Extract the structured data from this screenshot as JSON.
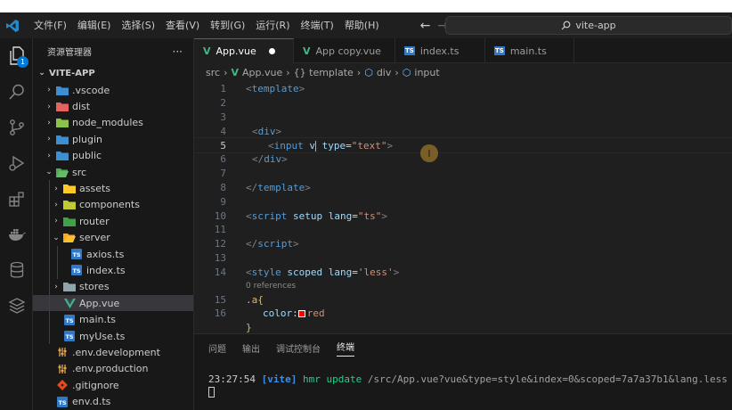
{
  "titlebar": {
    "menu": [
      "文件(F)",
      "编辑(E)",
      "选择(S)",
      "查看(V)",
      "转到(G)",
      "运行(R)",
      "终端(T)",
      "帮助(H)"
    ],
    "search_text": "vite-app"
  },
  "activity_bar": {
    "explorer_badge": "1"
  },
  "sidebar": {
    "header": "资源管理器",
    "more": "···",
    "section": "VITE-APP",
    "items": [
      {
        "label": ".vscode",
        "kind": "folder"
      },
      {
        "label": "dist",
        "kind": "folder"
      },
      {
        "label": "node_modules",
        "kind": "folder"
      },
      {
        "label": "plugin",
        "kind": "folder"
      },
      {
        "label": "public",
        "kind": "folder"
      },
      {
        "label": "src",
        "kind": "folder-open"
      },
      {
        "label": "assets",
        "kind": "folder"
      },
      {
        "label": "components",
        "kind": "folder"
      },
      {
        "label": "router",
        "kind": "folder"
      },
      {
        "label": "server",
        "kind": "folder-open"
      },
      {
        "label": "axios.ts",
        "kind": "ts"
      },
      {
        "label": "index.ts",
        "kind": "ts"
      },
      {
        "label": "stores",
        "kind": "folder"
      },
      {
        "label": "App.vue",
        "kind": "vue"
      },
      {
        "label": "main.ts",
        "kind": "ts"
      },
      {
        "label": "myUse.ts",
        "kind": "ts"
      },
      {
        "label": ".env.development",
        "kind": "env"
      },
      {
        "label": ".env.production",
        "kind": "env"
      },
      {
        "label": ".gitignore",
        "kind": "git"
      },
      {
        "label": "env.d.ts",
        "kind": "ts"
      }
    ]
  },
  "tabs": [
    {
      "label": "App.vue",
      "icon": "V"
    },
    {
      "label": "App copy.vue",
      "icon": "V"
    },
    {
      "label": "index.ts",
      "icon": "TS"
    },
    {
      "label": "main.ts",
      "icon": "TS"
    }
  ],
  "breadcrumb": [
    "src",
    "App.vue",
    "{} template",
    "div",
    "input"
  ],
  "editor": {
    "line_numbers": [
      "1",
      "2",
      "3",
      "4",
      "5",
      "6",
      "7",
      "8",
      "9",
      "10",
      "11",
      "12",
      "13",
      "14",
      "15",
      "16"
    ],
    "references_label": "0 references",
    "tokens": {
      "template_open": "template",
      "div_tag": "div",
      "input_tag": "input",
      "input_typed": "v",
      "type_attr": "type",
      "type_value": "\"text\"",
      "template_close": "template",
      "script_tag": "script",
      "setup_attr": "setup",
      "lang_attr": "lang",
      "lang_ts": "\"ts\"",
      "style_tag": "style",
      "scoped_attr": "scoped",
      "lang_less": "'less'",
      "selector": ".a{",
      "prop_color": "color",
      "value_red": "red",
      "close_brace": "}"
    }
  },
  "panel": {
    "tabs": [
      "问题",
      "输出",
      "调试控制台",
      "终端"
    ],
    "terminal": {
      "time": "23:27:54",
      "tag": "[vite]",
      "message": "hmr update",
      "path": "/src/App.vue?vue&type=style&index=0&scoped=7a7a37b1&lang.less"
    }
  },
  "colors": {
    "accent": "#0078d4",
    "vue_green": "#41b883",
    "ts_blue": "#3178c6"
  }
}
